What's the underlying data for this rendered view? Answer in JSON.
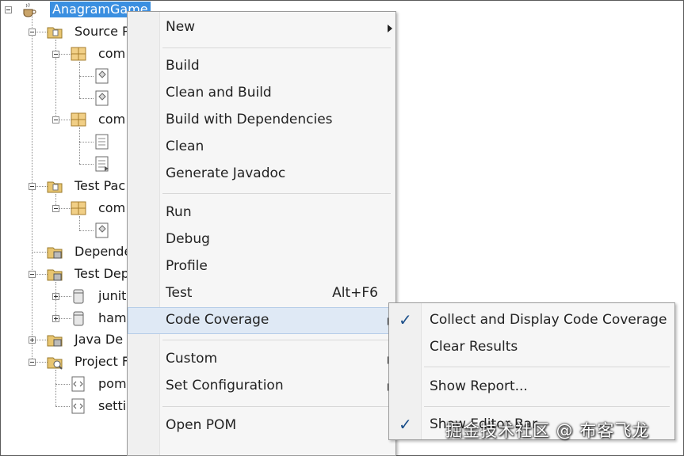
{
  "tree": {
    "root": "AnagramGame",
    "nodes": {
      "source_packages": "Source P",
      "pkg1": "com",
      "pkg2": "com",
      "test_packages": "Test Pac",
      "test_pkg": "com",
      "dependencies": "Depende",
      "test_dependencies": "Test Dep",
      "junit": "junit",
      "hamcrest": "ham",
      "java_dependencies": "Java De",
      "project_files": "Project F",
      "pom": "pom",
      "settings": "setti"
    }
  },
  "context_menu": {
    "items": [
      {
        "label": "New",
        "submenu": true
      },
      {
        "label": "Build"
      },
      {
        "label": "Clean and Build"
      },
      {
        "label": "Build with Dependencies"
      },
      {
        "label": "Clean"
      },
      {
        "label": "Generate Javadoc"
      },
      {
        "label": "Run"
      },
      {
        "label": "Debug"
      },
      {
        "label": "Profile"
      },
      {
        "label": "Test",
        "shortcut": "Alt+F6"
      },
      {
        "label": "Code Coverage",
        "submenu": true,
        "highlighted": true
      },
      {
        "label": "Custom",
        "submenu": true
      },
      {
        "label": "Set Configuration",
        "submenu": true
      },
      {
        "label": "Open POM"
      }
    ]
  },
  "coverage_submenu": {
    "items": [
      {
        "label": "Collect and Display Code Coverage",
        "checked": true
      },
      {
        "label": "Clear Results"
      },
      {
        "label": "Show Report..."
      },
      {
        "label": "Show Editor Bar",
        "checked": true
      }
    ],
    "check_glyph": "✓"
  },
  "watermark": "掘金技术社区 @ 布客飞龙",
  "colors": {
    "selection": "#3b8fe0",
    "menu_bg": "#f6f6f6",
    "highlight": "#dfe9f5",
    "check": "#1b4f8a"
  }
}
